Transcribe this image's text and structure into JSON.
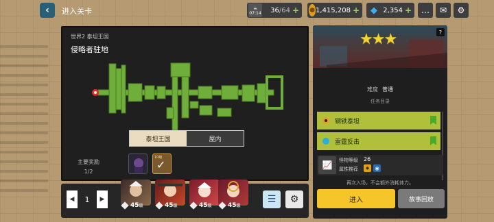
{
  "header": {
    "back_icon": "chevron-left-icon",
    "title": "进入关卡",
    "stamina": {
      "value": "36",
      "max": "/64",
      "time": "07:14",
      "icon": "coffee-cup-icon"
    },
    "gold": {
      "value": "1,415,208",
      "icon": "gold-coin-icon"
    },
    "gems": {
      "value": "2,354",
      "icon": "diamond-icon"
    },
    "plus": "+",
    "icons": [
      "chat-bubble-icon",
      "mail-icon",
      "settings-gear-icon"
    ]
  },
  "map": {
    "world": "世界2  泰坦王国",
    "stage": "侵略者驻地",
    "tabs": [
      {
        "label": "泰坦王国",
        "active": true
      },
      {
        "label": "屋内",
        "active": false
      }
    ],
    "reward_label": "主要奖励",
    "reward_count": "1/2",
    "reward_small": "10级",
    "reward_check": "✓",
    "colors": {
      "room": "#6fae3a",
      "room_border": "#4a7a22",
      "marker": "#e2282c"
    }
  },
  "bottom": {
    "page": "1",
    "prev": "◀",
    "next": "▶",
    "heroes": [
      {
        "level": "45",
        "unit": "级"
      },
      {
        "level": "45",
        "unit": "级"
      },
      {
        "level": "45",
        "unit": "级"
      },
      {
        "level": "45",
        "unit": "级"
      }
    ],
    "list_icon": "list-icon",
    "gear_icon": "gear-icon"
  },
  "stage_panel": {
    "stars": "★★★",
    "help": "?",
    "difficulty_label": "难度",
    "difficulty_value": "普通",
    "mission_title": "任务目录",
    "quests": [
      {
        "label": "钢铁泰坦",
        "ring_color": "#e8a020"
      },
      {
        "label": "雷霆反击",
        "ring_color": "#2ab0d8"
      }
    ],
    "monster_level_label": "怪物等级",
    "monster_level": "26",
    "recommend_label": "属性推荐",
    "note": "再次入场，不会额外消耗体力。",
    "enter": "进入",
    "replay": "故事回放"
  }
}
